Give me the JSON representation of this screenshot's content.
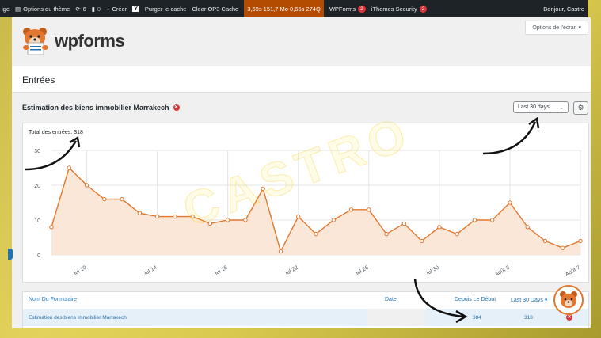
{
  "adminbar": {
    "site_label": "ige",
    "theme_options": "Options du thème",
    "updates_count": "6",
    "comments_count": "0",
    "create_label": "Créer",
    "purge_cache": "Purger le cache",
    "clear_cache": "Clear OP3 Cache",
    "perf_text": "3,69s  151,7 Mo  0,65s  274Q",
    "wpforms_label": "WPForms",
    "wpforms_badge": "2",
    "security_label": "iThemes Security",
    "security_badge": "2",
    "greeting": "Bonjour, Castro"
  },
  "brand": {
    "logo_text": "wpforms",
    "screen_options": "Options de l'écran"
  },
  "page": {
    "title": "Entrées",
    "form_name": "Estimation des biens immobilier Marrakech",
    "period": "Last 30 days",
    "watermark": "CASTRO"
  },
  "chart_data": {
    "type": "area",
    "title": "Total des entrées: 318",
    "x": [
      "Jul 8",
      "Jul 9",
      "Jul 10",
      "Jul 11",
      "Jul 12",
      "Jul 13",
      "Jul 14",
      "Jul 15",
      "Jul 16",
      "Jul 17",
      "Jul 18",
      "Jul 19",
      "Jul 20",
      "Jul 21",
      "Jul 22",
      "Jul 23",
      "Jul 24",
      "Jul 25",
      "Jul 26",
      "Jul 27",
      "Jul 28",
      "Jul 29",
      "Jul 30",
      "Jul 31",
      "Août 1",
      "Août 2",
      "Août 3",
      "Août 4",
      "Août 5",
      "Août 6",
      "Août 7"
    ],
    "values": [
      8,
      25,
      20,
      16,
      16,
      12,
      11,
      11,
      11,
      9,
      10,
      10,
      19,
      1,
      11,
      6,
      10,
      13,
      13,
      6,
      9,
      4,
      8,
      6,
      10,
      10,
      15,
      8,
      4,
      2,
      4
    ],
    "xticks": [
      "Jul 10",
      "Jul 14",
      "Jul 18",
      "Jul 22",
      "Jul 26",
      "Jul 30",
      "Août 3",
      "Août 7"
    ],
    "yticks": [
      0,
      10,
      20,
      30
    ],
    "ylim": [
      0,
      30
    ],
    "grid": true,
    "color": "#e27730",
    "fill": "#fbe7d8"
  },
  "table": {
    "headers": {
      "form": "Nom Du Formulaire",
      "date": "Date",
      "since": "Depuis Le Début",
      "last30": "Last 30 Days"
    },
    "row": {
      "form": "Estimation des biens immobilier Marrakech",
      "since": "384",
      "last30": "318"
    }
  }
}
